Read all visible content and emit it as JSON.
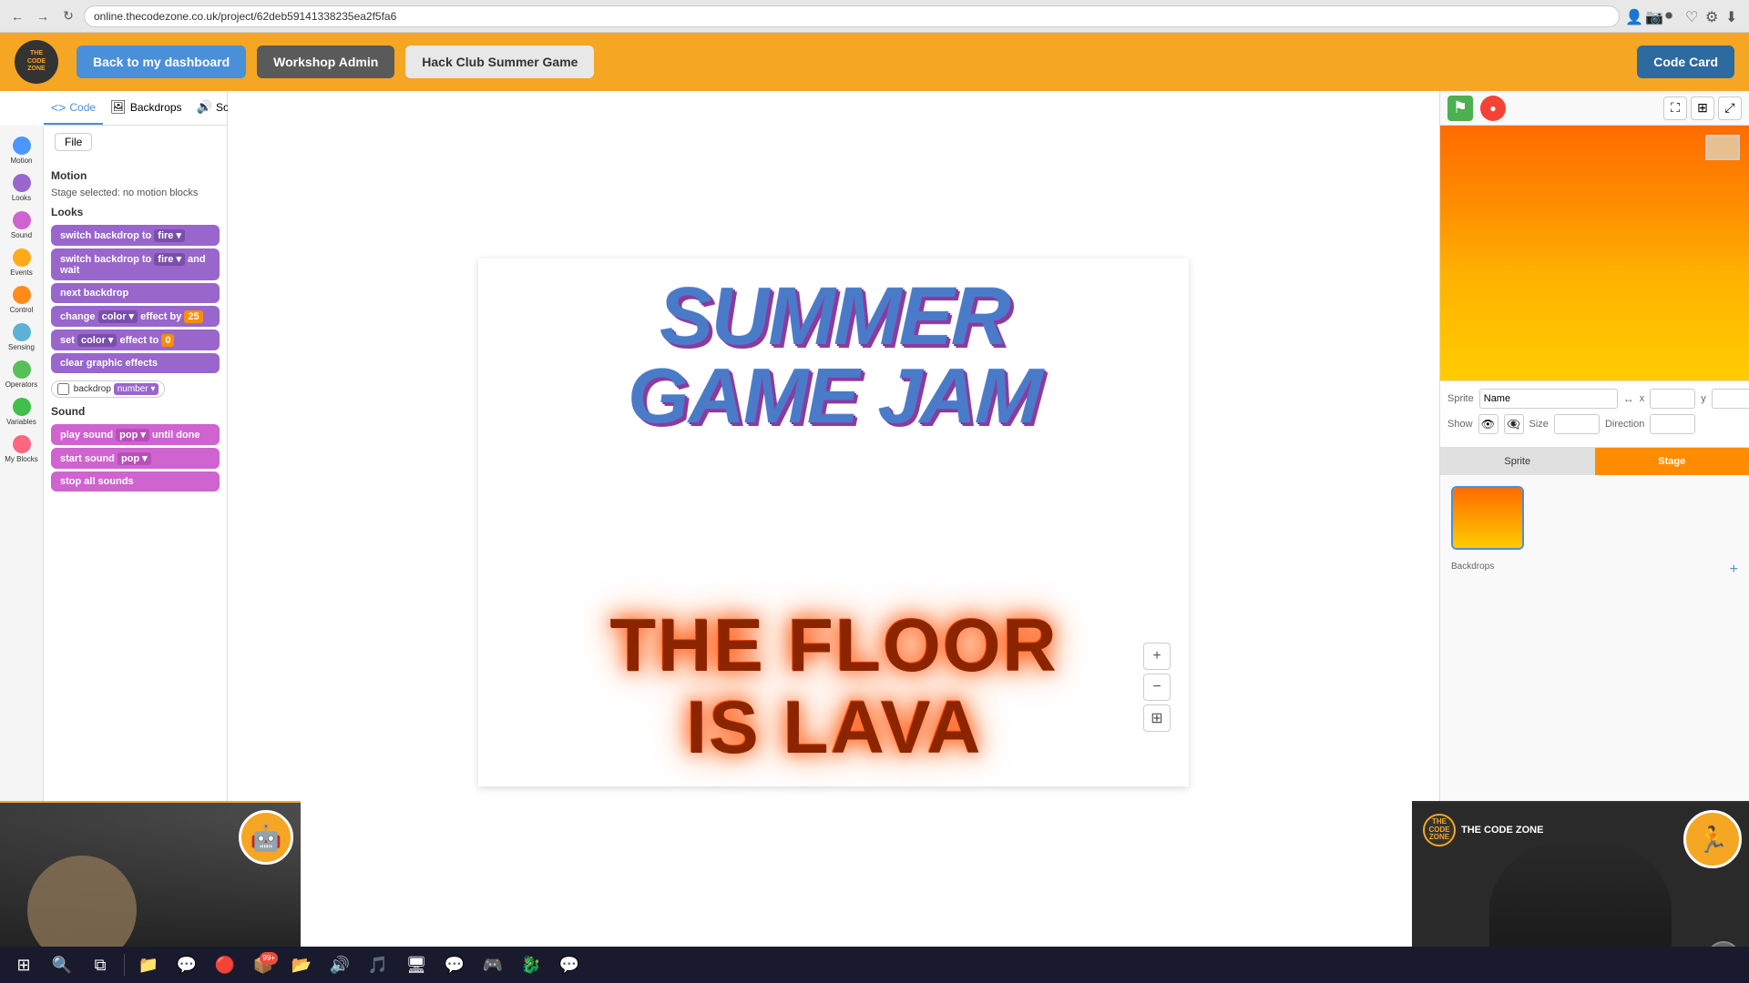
{
  "browser": {
    "url": "online.thecodezone.co.uk/project/62deb59141338235ea2f5fa6",
    "back": "←",
    "forward": "→",
    "refresh": "↻"
  },
  "header": {
    "logo_text": "THE CODE ZONE",
    "back_btn": "Back to my dashboard",
    "admin_btn": "Workshop Admin",
    "hackclub_btn": "Hack Club Summer Game",
    "codecard_btn": "Code Card"
  },
  "sidebar": {
    "tab_code": "Code",
    "tab_backdrops": "Backdrops",
    "tab_sounds": "Sounds",
    "file_label": "File",
    "categories": [
      {
        "name": "Motion",
        "color": "blue"
      },
      {
        "name": "Looks",
        "color": "purple"
      },
      {
        "name": "Sound",
        "color": "pink"
      },
      {
        "name": "Events",
        "color": "orange"
      },
      {
        "name": "Control",
        "color": "orange2"
      },
      {
        "name": "Sensing",
        "color": "cyan"
      },
      {
        "name": "Operators",
        "color": "green"
      },
      {
        "name": "Variables",
        "color": "darkgreen"
      },
      {
        "name": "My Blocks",
        "color": "gray"
      }
    ],
    "motion_label": "Motion",
    "motion_sub": "Stage selected: no motion blocks",
    "looks_label": "Looks",
    "blocks": [
      {
        "label": "switch backdrop to  fire  ▾",
        "type": "purple"
      },
      {
        "label": "switch backdrop to  fire ▾  and wait",
        "type": "purple"
      },
      {
        "label": "next backdrop",
        "type": "purple"
      },
      {
        "label": "change  color ▾  effect by  25",
        "type": "purple"
      },
      {
        "label": "set  color ▾  effect to  0",
        "type": "purple"
      },
      {
        "label": "clear graphic effects",
        "type": "purple"
      }
    ],
    "backdrop_block": "backdrop  number ▾",
    "sound_label": "Sound",
    "sound_blocks": [
      {
        "label": "play sound  pop ▾  until done",
        "type": "sound"
      },
      {
        "label": "start sound  pop ▾",
        "type": "sound"
      },
      {
        "label": "stop all sounds",
        "type": "sound"
      }
    ]
  },
  "stage": {
    "title_line1": "SUMMER",
    "title_line2": "GAME  JAM",
    "floor_line1": "THE FLOOR",
    "floor_line2": "IS LAVA"
  },
  "inspector": {
    "sprite_label": "Sprite",
    "sprite_name": "Name",
    "x_label": "x",
    "x_value": "",
    "y_label": "y",
    "y_value": "",
    "show_label": "Show",
    "size_label": "Size",
    "size_value": "",
    "direction_label": "Direction",
    "direction_value": "",
    "tab_sprite": "Sprite",
    "tab_stage": "Stage",
    "backdrop_label": "Backdrops"
  },
  "right_panel": {
    "green_flag_icon": "⚑",
    "stop_icon": "●"
  },
  "taskbar": {
    "items": [
      "⊞",
      "🔍",
      "📁",
      "💬",
      "🔴",
      "📦",
      "99+",
      "📂",
      "🔊",
      "🎵",
      "🖥",
      "💬",
      "🎮",
      "🐉",
      "💬"
    ]
  }
}
